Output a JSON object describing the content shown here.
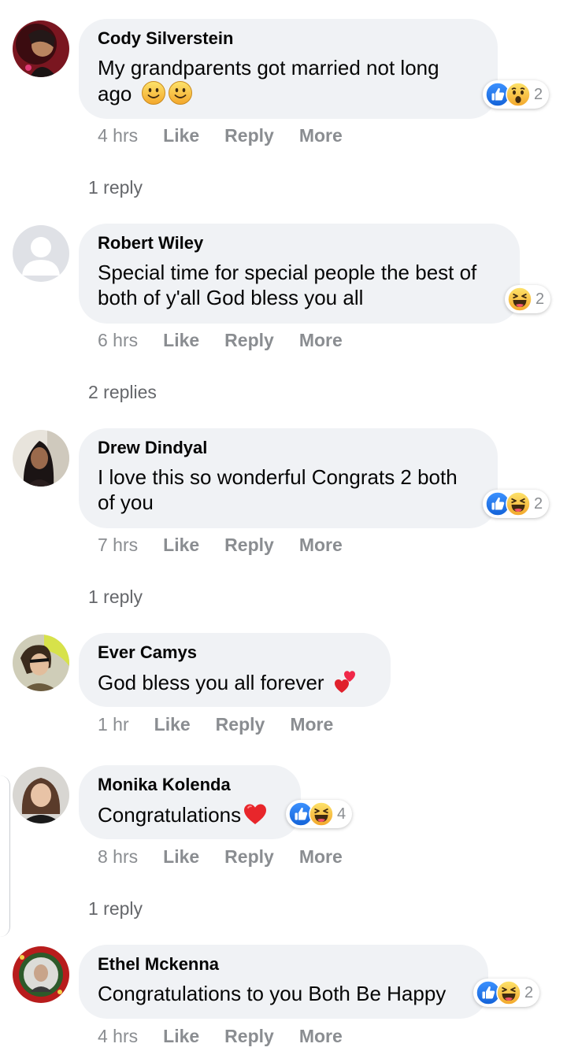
{
  "comments": [
    {
      "author": "Cody Silverstein",
      "text": "My grandparents got married not long ago",
      "emojis": [
        "slightly-smiling-face",
        "slightly-smiling-face"
      ],
      "time": "4 hrs",
      "like": "Like",
      "reply": "Reply",
      "more": "More",
      "reaction_icons": [
        "like-reaction",
        "wow-reaction"
      ],
      "reaction_count": "2",
      "replies": "1 reply"
    },
    {
      "author": "Robert Wiley",
      "text": "Special time for special people the best of both of y'all God bless you all",
      "time": "6 hrs",
      "like": "Like",
      "reply": "Reply",
      "more": "More",
      "reaction_icons": [
        "haha-reaction"
      ],
      "reaction_count": "2",
      "replies": "2 replies"
    },
    {
      "author": "Drew Dindyal",
      "text": "I love this so wonderful Congrats 2 both of you",
      "time": "7 hrs",
      "like": "Like",
      "reply": "Reply",
      "more": "More",
      "reaction_icons": [
        "like-reaction",
        "haha-reaction"
      ],
      "reaction_count": "2",
      "replies": "1 reply"
    },
    {
      "author": "Ever Camys",
      "text": "God bless you all forever",
      "emojis": [
        "two-hearts"
      ],
      "time": "1 hr",
      "like": "Like",
      "reply": "Reply",
      "more": "More"
    },
    {
      "author": "Monika Kolenda",
      "text": "Congratulations",
      "emojis": [
        "red-heart"
      ],
      "time": "8 hrs",
      "like": "Like",
      "reply": "Reply",
      "more": "More",
      "reaction_icons": [
        "like-reaction",
        "haha-reaction"
      ],
      "reaction_count": "4",
      "replies": "1 reply"
    },
    {
      "author": "Ethel Mckenna",
      "text": "Congratulations to you Both Be Happy",
      "time": "4 hrs",
      "like": "Like",
      "reply": "Reply",
      "more": "More",
      "reaction_icons": [
        "like-reaction",
        "haha-reaction"
      ],
      "reaction_count": "2"
    }
  ],
  "colors": {
    "bubble": "#f0f2f5",
    "meta_text": "#8a8d91",
    "like_blue": "#1877f2",
    "reaction_yellow": "#f7b928"
  }
}
